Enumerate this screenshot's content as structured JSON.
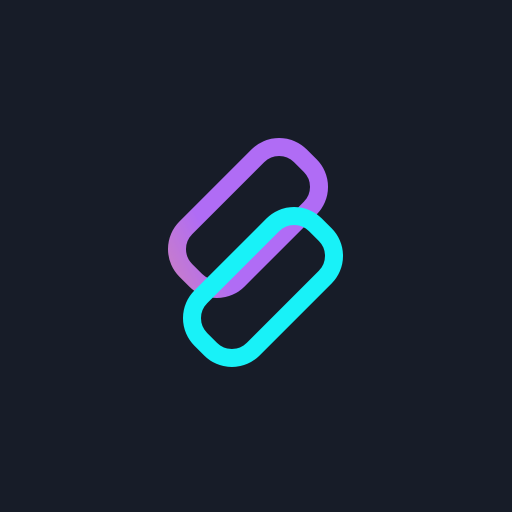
{
  "app_icon": {
    "icon": "interlinked-rounded-rectangles-logo-icon",
    "background_color": "#171c28",
    "back_link": {
      "gradient_start": "#b06cf5",
      "gradient_end": "#ffa468"
    },
    "front_link": {
      "gradient_start": "#18f2f8",
      "gradient_end": "#6aa6ff"
    }
  }
}
